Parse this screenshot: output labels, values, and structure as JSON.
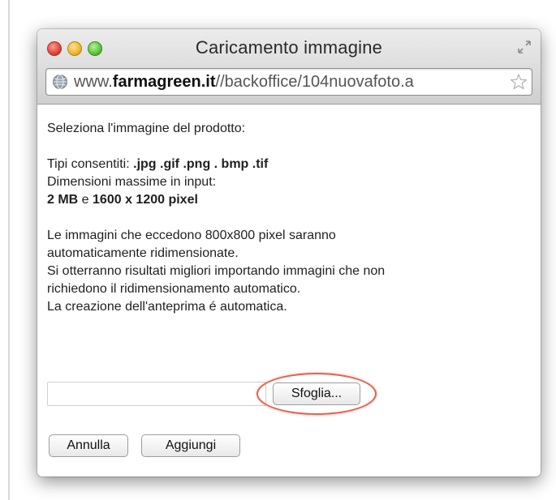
{
  "window": {
    "title": "Caricamento immagine",
    "url_prefix": "www.",
    "url_domain": "farmagreen.it",
    "url_path": "//backoffice/104nuovafoto.a"
  },
  "content": {
    "intro": "Seleziona l'immagine del prodotto:",
    "types_label": "Tipi consentiti: ",
    "types_value": ".jpg .gif .png . bmp .tif",
    "max_label": "Dimensioni massime in input:",
    "max_size": "2 MB",
    "max_joiner": " e ",
    "max_res": "1600 x 1200 pixel",
    "resize_line1": "Le immagini che eccedono 800x800 pixel saranno",
    "resize_line2": "automaticamente ridimensionate.",
    "tip_line1": "Si otterranno risultati migliori importando immagini che non",
    "tip_line2": "richiedono il ridimensionamento automatico.",
    "preview_line": "La creazione dell'anteprima é automatica."
  },
  "form": {
    "file_value": "",
    "browse_label": "Sfoglia...",
    "cancel_label": "Annulla",
    "add_label": "Aggiungi"
  },
  "colors": {
    "highlight": "#e2614c",
    "close": "#e0443a",
    "minimize": "#f0b42a",
    "zoom": "#5cc43a"
  },
  "icons": [
    "close-icon",
    "minimize-icon",
    "zoom-icon",
    "fullscreen-icon",
    "globe-icon",
    "star-icon"
  ]
}
